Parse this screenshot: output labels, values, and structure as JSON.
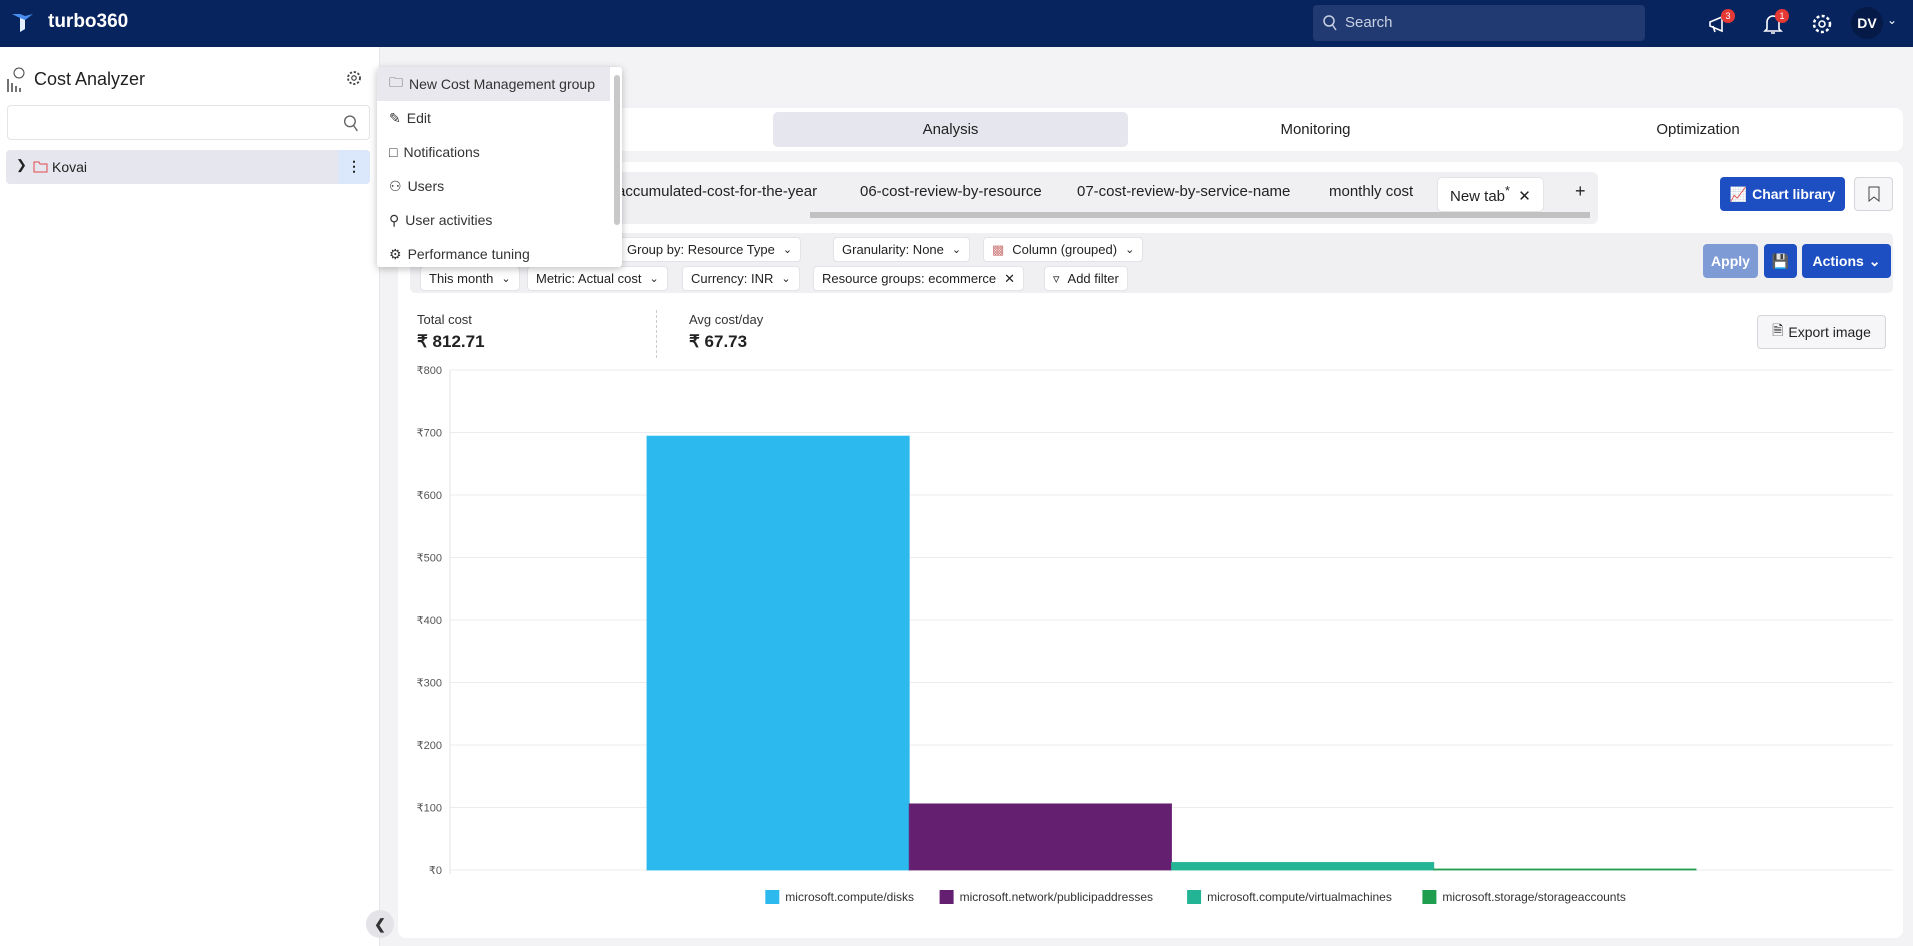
{
  "header": {
    "brand": "turbo360",
    "search_placeholder": "Search",
    "announcements_count": "3",
    "notifications_count": "1",
    "user_initials": "DV"
  },
  "sidebar": {
    "title": "Cost Analyzer",
    "search_value": "",
    "tree": [
      {
        "label": "Kovai",
        "icon": "folder-icon"
      }
    ]
  },
  "context_menu": {
    "items": [
      {
        "label": "New Cost Management group",
        "icon": "folder-icon"
      },
      {
        "label": "Edit",
        "icon": "pencil-icon"
      },
      {
        "label": "Notifications",
        "icon": "notification-icon"
      },
      {
        "label": "Users",
        "icon": "users-icon"
      },
      {
        "label": "User activities",
        "icon": "user-activity-icon"
      },
      {
        "label": "Performance tuning",
        "icon": "gear-icon"
      }
    ]
  },
  "nav_tabs": [
    {
      "label": "Analysis",
      "active": true
    },
    {
      "label": "Monitoring"
    },
    {
      "label": "Optimization"
    }
  ],
  "report_tabs": [
    "accumulated-cost-for-the-year",
    "06-cost-review-by-resource",
    "07-cost-review-by-service-name",
    "monthly cost"
  ],
  "active_tab": {
    "label": "New tab",
    "modified_mark": "*"
  },
  "toolbar": {
    "chart_library": "Chart library",
    "apply": "Apply",
    "actions": "Actions",
    "export_image": "Export image"
  },
  "filters": {
    "group_by": "Group by: Resource Type",
    "granularity": "Granularity: None",
    "chart_type": "Column (grouped)",
    "time": "This month",
    "metric": "Metric: Actual cost",
    "currency": "Currency: INR",
    "resource_groups": "Resource groups: ecommerce",
    "add_filter": "Add filter"
  },
  "stats": {
    "total_label": "Total cost",
    "total_value": "₹ 812.71",
    "avg_label": "Avg cost/day",
    "avg_value": "₹ 67.73"
  },
  "chart_data": {
    "type": "bar",
    "grouping": "grouped",
    "ylim": [
      0,
      800
    ],
    "yticks": [
      "₹0",
      "₹100",
      "₹200",
      "₹300",
      "₹400",
      "₹500",
      "₹600",
      "₹700",
      "₹800"
    ],
    "ytick_values": [
      0,
      100,
      200,
      300,
      400,
      500,
      600,
      700,
      800
    ],
    "grid": true,
    "legend": "bottom",
    "series": [
      {
        "name": "microsoft.compute/disks",
        "value": 694.2,
        "color": "#2cb9ed"
      },
      {
        "name": "microsoft.network/publicipaddresses",
        "value": 105.8,
        "color": "#651f71"
      },
      {
        "name": "microsoft.compute/virtualmachines",
        "value": 12.1,
        "color": "#22b495"
      },
      {
        "name": "microsoft.storage/storageaccounts",
        "value": 0.61,
        "color": "#1e9e4e"
      }
    ]
  }
}
